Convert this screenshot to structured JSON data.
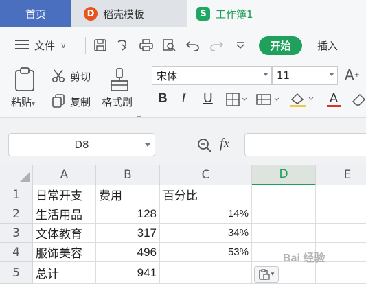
{
  "tabs": {
    "home": "首页",
    "templates": "稻壳模板",
    "workbook": "工作簿1",
    "templates_icon": "D",
    "workbook_icon": "S"
  },
  "menu": {
    "file": "文件",
    "start": "开始",
    "insert": "插入"
  },
  "ribbon": {
    "paste": "粘贴",
    "cut": "剪切",
    "copy": "复制",
    "format_painter": "格式刷",
    "font_name": "宋体",
    "font_size": "11",
    "bold": "B",
    "italic": "I",
    "underline": "U",
    "font_color_glyph": "A"
  },
  "formula_bar": {
    "name_box": "D8",
    "fx": "fx"
  },
  "grid": {
    "columns": [
      "A",
      "B",
      "C",
      "D",
      "E"
    ],
    "rows": [
      "1",
      "2",
      "3",
      "4",
      "5"
    ],
    "cells": [
      [
        "日常开支",
        "费用",
        "百分比",
        "",
        ""
      ],
      [
        "生活用品",
        "128",
        "14%",
        "",
        ""
      ],
      [
        "文体教育",
        "317",
        "34%",
        "",
        ""
      ],
      [
        "服饰美容",
        "496",
        "53%",
        "",
        ""
      ],
      [
        "总计",
        "941",
        "",
        "",
        ""
      ]
    ]
  },
  "watermark": "Bai 经验",
  "colors": {
    "accent": "#1e9c5a",
    "home_tab": "#4a6fbf",
    "start_button": "#1fa05c",
    "font_color_bar": "#e0302b"
  }
}
